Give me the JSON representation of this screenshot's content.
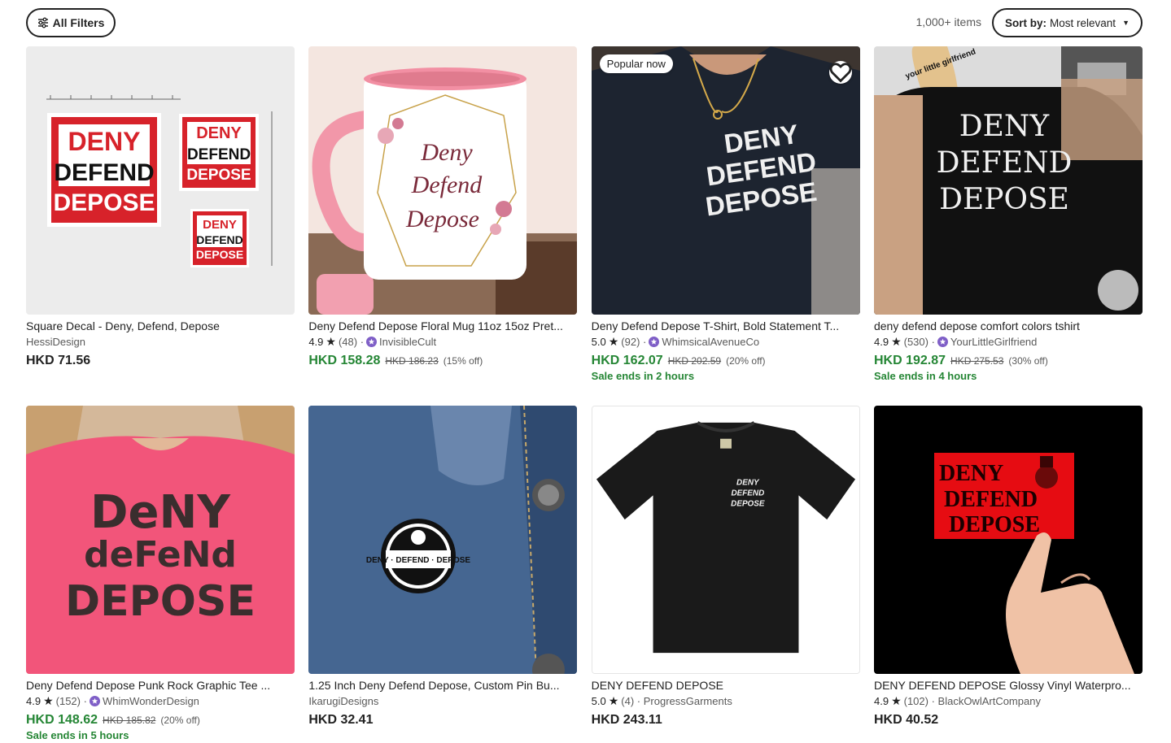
{
  "toolbar": {
    "filters_label": "All Filters",
    "count": "1,000+ items",
    "sort_prefix": "Sort by:",
    "sort_value": "Most relevant"
  },
  "colors": {
    "sale_green": "#258635",
    "text": "#222222",
    "muted": "#595959"
  },
  "listings": [
    {
      "title": "Square Decal - Deny, Defend, Depose",
      "shop": "HessiDesign",
      "price": "HKD 71.56"
    },
    {
      "title": "Deny Defend Depose Floral Mug 11oz 15oz Pret...",
      "rating": "4.9",
      "reviews": "(48) ·",
      "shop": "InvisibleCult",
      "price": "HKD 158.28",
      "original_price": "HKD 186.23",
      "discount": "(15% off)"
    },
    {
      "title": "Deny Defend Depose T-Shirt, Bold Statement T...",
      "badge": "Popular now",
      "rating": "5.0",
      "reviews": "(92) ·",
      "shop": "WhimsicalAvenueCo",
      "price": "HKD 162.07",
      "original_price": "HKD 202.59",
      "discount": "(20% off)",
      "sale_ends": "Sale ends in 2 hours"
    },
    {
      "title": "deny defend depose comfort colors tshirt",
      "rating": "4.9",
      "reviews": "(530) ·",
      "shop": "YourLittleGirlfriend",
      "price": "HKD 192.87",
      "original_price": "HKD 275.53",
      "discount": "(30% off)",
      "sale_ends": "Sale ends in 4 hours"
    },
    {
      "title": "Deny Defend Depose Punk Rock Graphic Tee ...",
      "rating": "4.9",
      "reviews": "(152) ·",
      "shop": "WhimWonderDesign",
      "price": "HKD 148.62",
      "original_price": "HKD 185.82",
      "discount": "(20% off)",
      "sale_ends": "Sale ends in 5 hours"
    },
    {
      "title": "1.25 Inch Deny Defend Depose, Custom Pin Bu...",
      "shop": "IkarugiDesigns",
      "price": "HKD 32.41"
    },
    {
      "title": "DENY DEFEND DEPOSE",
      "rating": "5.0",
      "reviews": "(4) · ProgressGarments",
      "price": "HKD 243.11"
    },
    {
      "title": "DENY DEFEND DEPOSE Glossy Vinyl Waterpro...",
      "rating": "4.9",
      "reviews": "(102) · BlackOwlArtCompany",
      "price": "HKD 40.52"
    }
  ],
  "artwork": {
    "decal": [
      "DENY",
      "DEFEND",
      "DEPOSE"
    ],
    "mug": [
      "Deny",
      "Defend",
      "Depose"
    ],
    "tee_black": [
      "DENY",
      "DEFEND",
      "DEPOSE"
    ],
    "tee_comfort": [
      "DENY",
      "DEFEND",
      "DEPOSE"
    ],
    "tee_comfort_tag": "your little girlfriend",
    "tee_pink": [
      "DeNY",
      "deFeNd",
      "DEPOSE"
    ],
    "pin": "DENY · DEFEND · DEPOSE",
    "tee_plain": [
      "DENY",
      "DEFEND",
      "DEPOSE"
    ],
    "sticker": [
      "DENY",
      "DEFEND",
      "DEPOSE"
    ]
  }
}
